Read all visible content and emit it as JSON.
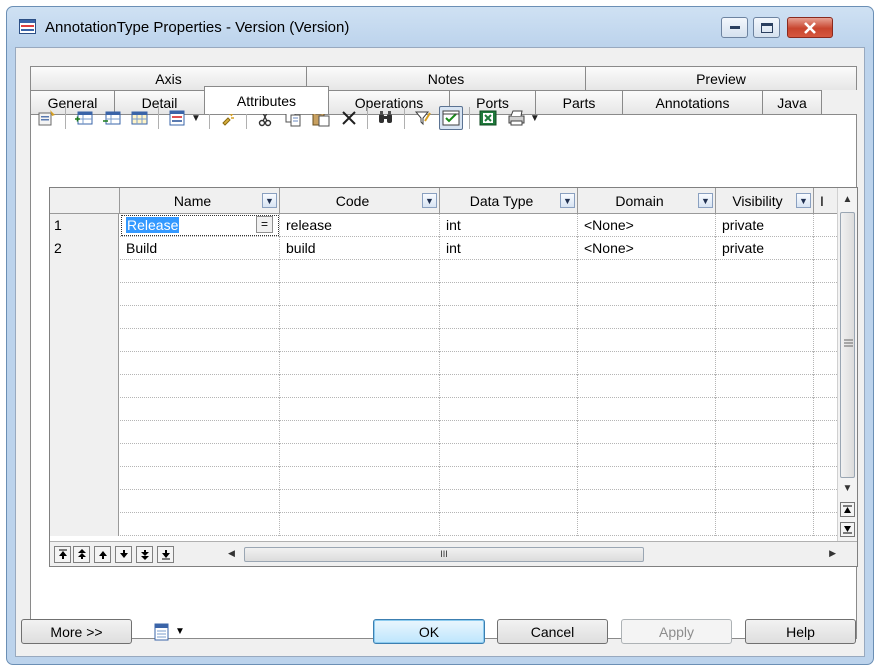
{
  "window": {
    "title": "AnnotationType Properties - Version (Version)"
  },
  "tabs_row1": [
    {
      "label": "Axis"
    },
    {
      "label": "Notes"
    },
    {
      "label": "Preview"
    }
  ],
  "tabs_row2": [
    {
      "label": "General"
    },
    {
      "label": "Detail"
    },
    {
      "label": "Attributes",
      "active": true
    },
    {
      "label": "Operations"
    },
    {
      "label": "Ports"
    },
    {
      "label": "Parts"
    },
    {
      "label": "Annotations"
    },
    {
      "label": "Java"
    }
  ],
  "toolbar_icons": [
    "properties-icon",
    "add-row-icon",
    "insert-row-icon",
    "add-attribute-icon",
    "customize-columns-icon",
    "filter-icon",
    "cut-icon",
    "copy-icon",
    "paste-icon",
    "delete-icon",
    "find-icon",
    "filter-funnel-icon",
    "select-columns-icon",
    "excel-export-icon",
    "print-icon"
  ],
  "grid": {
    "columns": [
      {
        "label": "Name"
      },
      {
        "label": "Code"
      },
      {
        "label": "Data Type"
      },
      {
        "label": "Domain"
      },
      {
        "label": "Visibility"
      },
      {
        "label": "I"
      }
    ],
    "rows": [
      {
        "num": "1",
        "name": "Release",
        "code": "release",
        "data_type": "int",
        "domain": "<None>",
        "visibility": "private"
      },
      {
        "num": "2",
        "name": "Build",
        "code": "build",
        "data_type": "int",
        "domain": "<None>",
        "visibility": "private"
      }
    ],
    "eq_button": "=",
    "hscroll_grip": "III"
  },
  "buttons": {
    "more": "More >>",
    "ok": "OK",
    "cancel": "Cancel",
    "apply": "Apply",
    "help": "Help"
  },
  "colors": {
    "selection": "#3399ff",
    "title_gradient": "#bcd3ec",
    "close_button": "#c8452e"
  }
}
